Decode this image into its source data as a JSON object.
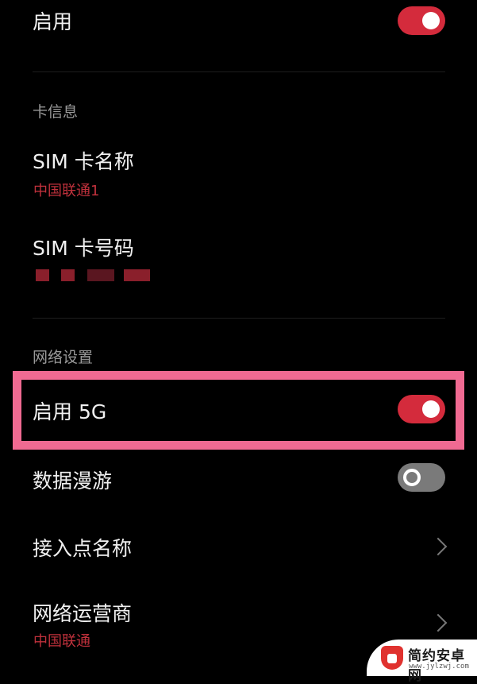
{
  "enable": {
    "label": "启用",
    "toggle_on": true
  },
  "card_info": {
    "section_label": "卡信息",
    "sim_name": {
      "label": "SIM 卡名称",
      "value": "中国联通1"
    },
    "sim_number": {
      "label": "SIM 卡号码",
      "value_redacted": true
    }
  },
  "network": {
    "section_label": "网络设置",
    "enable_5g": {
      "label": "启用 5G",
      "toggle_on": true,
      "highlighted": true
    },
    "data_roaming": {
      "label": "数据漫游",
      "toggle_on": false
    },
    "apn": {
      "label": "接入点名称"
    },
    "operator": {
      "label": "网络运营商",
      "value": "中国联通"
    }
  },
  "colors": {
    "accent": "#d42b3c",
    "highlight_box": "#f06a92",
    "toggle_off": "#7a7a7a",
    "subtext_red": "#c0313c"
  },
  "watermark": {
    "name": "简约安卓网",
    "url": "www.jylzwj.com"
  }
}
